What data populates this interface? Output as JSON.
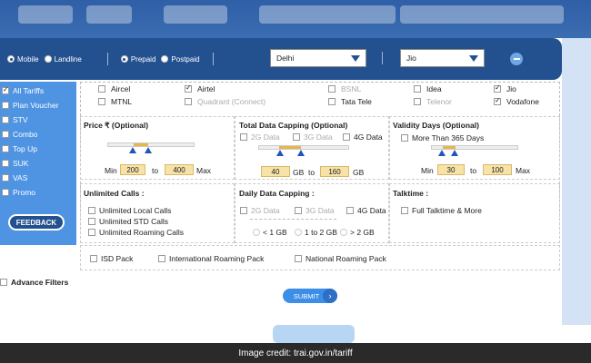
{
  "filter_bar": {
    "connection": {
      "mobile": "Mobile",
      "landline": "Landline",
      "selected": "Mobile"
    },
    "plan": {
      "prepaid": "Prepaid",
      "postpaid": "Postpaid",
      "selected": "Prepaid"
    },
    "circle": "Delhi",
    "operator": "Jio"
  },
  "sidebar": {
    "items": [
      {
        "label": "All Tariffs",
        "checked": true
      },
      {
        "label": "Plan Voucher",
        "checked": false
      },
      {
        "label": "STV",
        "checked": false
      },
      {
        "label": "Combo",
        "checked": false
      },
      {
        "label": "Top Up",
        "checked": false
      },
      {
        "label": "SUK",
        "checked": false
      },
      {
        "label": "VAS",
        "checked": false
      },
      {
        "label": "Promo",
        "checked": false
      }
    ],
    "feedback": "FEEDBACK"
  },
  "operators": [
    {
      "label": "Aircel",
      "checked": false,
      "disabled": false
    },
    {
      "label": "Airtel",
      "checked": true,
      "disabled": false
    },
    {
      "label": "BSNL",
      "checked": false,
      "disabled": true
    },
    {
      "label": "Idea",
      "checked": false,
      "disabled": false
    },
    {
      "label": "Jio",
      "checked": true,
      "disabled": false
    },
    {
      "label": "MTNL",
      "checked": false,
      "disabled": false
    },
    {
      "label": "Quadrant (Connect)",
      "checked": false,
      "disabled": true
    },
    {
      "label": "Tata Tele",
      "checked": false,
      "disabled": false
    },
    {
      "label": "Telenor",
      "checked": false,
      "disabled": true
    },
    {
      "label": "Vodafone",
      "checked": true,
      "disabled": false
    }
  ],
  "price": {
    "title": "Price ₹ (Optional)",
    "min_label": "Min",
    "min": "200",
    "to": "to",
    "max": "400",
    "max_label": "Max"
  },
  "total_data": {
    "title": "Total Data Capping (Optional)",
    "opt2g": "2G Data",
    "opt3g": "3G Data",
    "opt4g": "4G Data",
    "from": "40",
    "unit1": "GB",
    "to": "to",
    "till": "160",
    "unit2": "GB"
  },
  "validity": {
    "title": "Validity Days (Optional)",
    "more365": "More Than 365 Days",
    "min_label": "Min",
    "min": "30",
    "to": "to",
    "max": "100",
    "max_label": "Max"
  },
  "unlimited_calls": {
    "title": "Unlimited Calls :",
    "local": "Unlimited Local Calls",
    "std": "Unlimited STD Calls",
    "roaming": "Unlimited Roaming Calls"
  },
  "daily_data": {
    "title": "Daily Data Capping :",
    "opt2g": "2G Data",
    "opt3g": "3G Data",
    "opt4g": "4G Data",
    "lt1": "< 1 GB",
    "one_two": "1 to 2 GB",
    "gt2": "> 2 GB"
  },
  "talktime": {
    "title": "Talktime :",
    "full": "Full Talktime & More"
  },
  "packs": {
    "isd": "ISD Pack",
    "intl_roaming": "International Roaming Pack",
    "national_roaming": "National Roaming Pack"
  },
  "advance_filters": "Advance Filters",
  "submit": "SUBMIT",
  "credit": "Image credit: trai.gov.in/tariff",
  "colors": {
    "filter_bar": "#23508f",
    "sidebar": "#4f94e3",
    "submit": "#3d8ee6",
    "slider_fill": "#e8b54d"
  }
}
